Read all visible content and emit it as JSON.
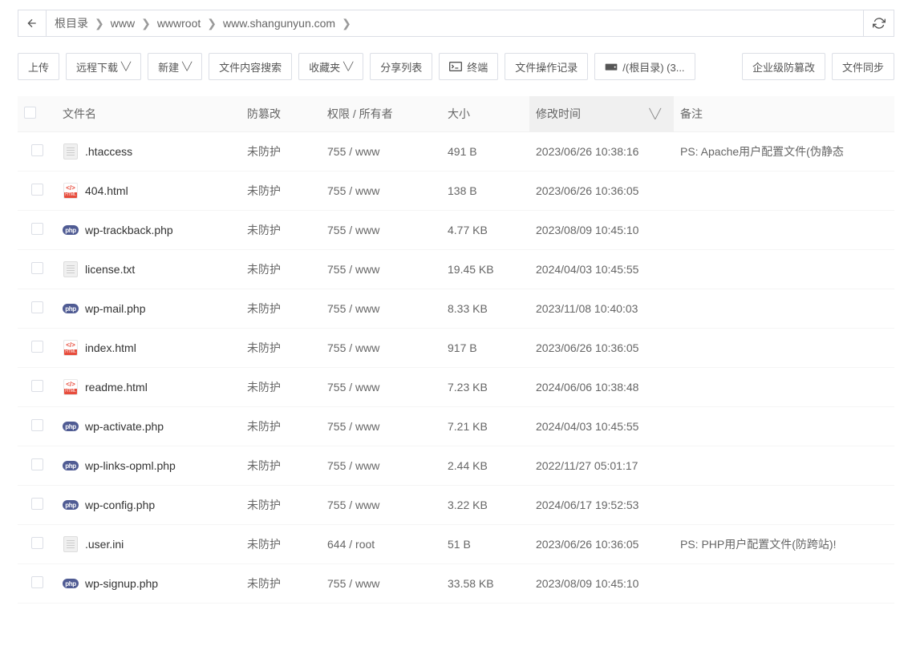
{
  "breadcrumb": {
    "items": [
      "根目录",
      "www",
      "wwwroot",
      "www.shangunyun.com"
    ]
  },
  "toolbar": {
    "upload": "上传",
    "remote_dl": "远程下载",
    "new": "新建",
    "search": "文件内容搜索",
    "favorites": "收藏夹",
    "share": "分享列表",
    "terminal": "终端",
    "ops_log": "文件操作记录",
    "storage": "/(根目录) (3...",
    "tamper_ent": "企业级防篡改",
    "sync": "文件同步"
  },
  "columns": {
    "name": "文件名",
    "protect": "防篡改",
    "perm": "权限 / 所有者",
    "size": "大小",
    "mtime": "修改时间",
    "remark": "备注"
  },
  "protect_label": "未防护",
  "files": [
    {
      "name": ".htaccess",
      "type": "generic",
      "perm": "755 / www",
      "size": "491 B",
      "mtime": "2023/06/26 10:38:16",
      "remark": "PS: Apache用户配置文件(伪静态"
    },
    {
      "name": "404.html",
      "type": "html",
      "perm": "755 / www",
      "size": "138 B",
      "mtime": "2023/06/26 10:36:05",
      "remark": ""
    },
    {
      "name": "wp-trackback.php",
      "type": "php",
      "perm": "755 / www",
      "size": "4.77 KB",
      "mtime": "2023/08/09 10:45:10",
      "remark": ""
    },
    {
      "name": "license.txt",
      "type": "generic",
      "perm": "755 / www",
      "size": "19.45 KB",
      "mtime": "2024/04/03 10:45:55",
      "remark": ""
    },
    {
      "name": "wp-mail.php",
      "type": "php",
      "perm": "755 / www",
      "size": "8.33 KB",
      "mtime": "2023/11/08 10:40:03",
      "remark": ""
    },
    {
      "name": "index.html",
      "type": "html",
      "perm": "755 / www",
      "size": "917 B",
      "mtime": "2023/06/26 10:36:05",
      "remark": ""
    },
    {
      "name": "readme.html",
      "type": "html",
      "perm": "755 / www",
      "size": "7.23 KB",
      "mtime": "2024/06/06 10:38:48",
      "remark": ""
    },
    {
      "name": "wp-activate.php",
      "type": "php",
      "perm": "755 / www",
      "size": "7.21 KB",
      "mtime": "2024/04/03 10:45:55",
      "remark": ""
    },
    {
      "name": "wp-links-opml.php",
      "type": "php",
      "perm": "755 / www",
      "size": "2.44 KB",
      "mtime": "2022/11/27 05:01:17",
      "remark": ""
    },
    {
      "name": "wp-config.php",
      "type": "php",
      "perm": "755 / www",
      "size": "3.22 KB",
      "mtime": "2024/06/17 19:52:53",
      "remark": ""
    },
    {
      "name": ".user.ini",
      "type": "generic",
      "perm": "644 / root",
      "size": "51 B",
      "mtime": "2023/06/26 10:36:05",
      "remark": "PS: PHP用户配置文件(防跨站)!"
    },
    {
      "name": "wp-signup.php",
      "type": "php",
      "perm": "755 / www",
      "size": "33.58 KB",
      "mtime": "2023/08/09 10:45:10",
      "remark": ""
    }
  ]
}
